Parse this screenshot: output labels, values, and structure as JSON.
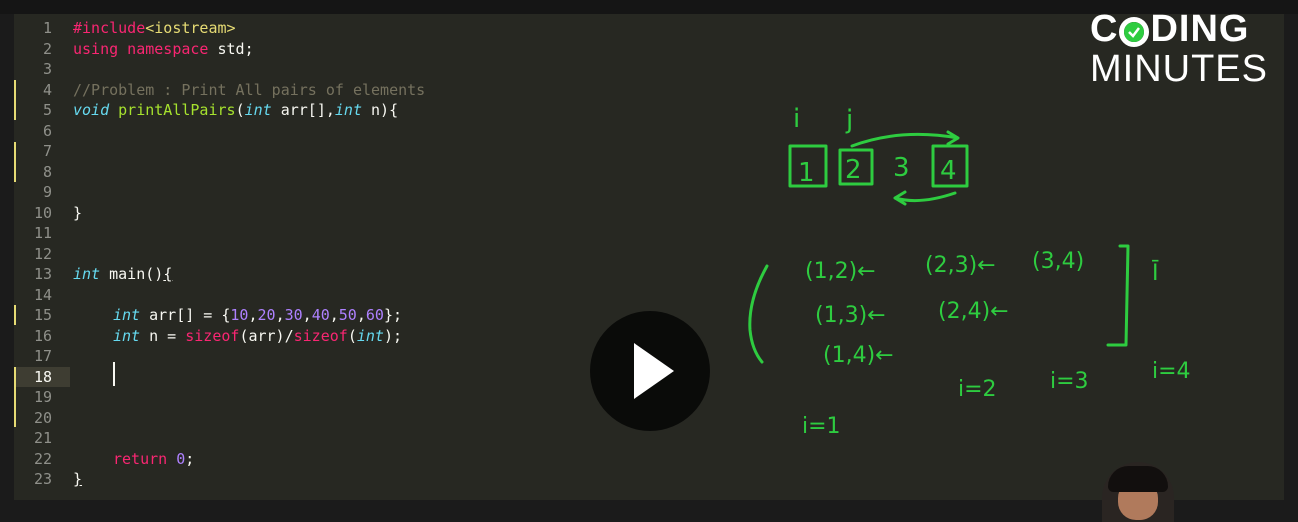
{
  "editor": {
    "active_line": 18,
    "line_numbers": [
      "1",
      "2",
      "3",
      "4",
      "5",
      "6",
      "7",
      "8",
      "9",
      "10",
      "11",
      "12",
      "13",
      "14",
      "15",
      "16",
      "17",
      "18",
      "19",
      "20",
      "21",
      "22",
      "23"
    ],
    "lines": {
      "l1_pre": "#include",
      "l1_post": "<iostream>",
      "l2_kw": "using namespace",
      "l2_rest": " std;",
      "l4": "//Problem : Print All pairs of elements",
      "l5_void": "void",
      "l5_fn": "printAllPairs",
      "l5_p1": "(",
      "l5_int1": "int",
      "l5_p2": " arr[],",
      "l5_int2": "int",
      "l5_p3": " n){",
      "l10": "}",
      "l13_int": "int",
      "l13_main": " main()",
      "l13_brace": "{",
      "l15_int": "int",
      "l15_a": " arr[] = {",
      "l15_n1": "10",
      "l15_n2": "20",
      "l15_n3": "30",
      "l15_n4": "40",
      "l15_n5": "50",
      "l15_n6": "60",
      "l15_b": "};",
      "comma": ",",
      "l16_int": "int",
      "l16_a": " n = ",
      "l16_sz1": "sizeof",
      "l16_b": "(arr)/",
      "l16_sz2": "sizeof",
      "l16_c": "(",
      "l16_int2": "int",
      "l16_d": ");",
      "l22_ret": "return",
      "l22_zero": "0",
      "l22_semi": ";",
      "l23": "}"
    }
  },
  "logo": {
    "line1_a": "C",
    "line1_b": "DING",
    "line2": "MINUTES"
  },
  "video": {
    "play_button_icon": "play-icon"
  },
  "handwriting": {
    "i_label": "i",
    "j_label": "j",
    "boxes": [
      "1",
      "2",
      "3",
      "4"
    ],
    "pairs_row1": [
      "(1,2)←",
      "(2,3)←",
      "(3,4)"
    ],
    "pairs_row2": [
      "(1,3)←",
      "(2,4)←"
    ],
    "pairs_row3": [
      "(1,4)←"
    ],
    "iter_labels": [
      "i=1",
      "i=2",
      "i=3",
      "i=4"
    ],
    "roman": "Ī"
  },
  "colors": {
    "background": "#272822",
    "ink": "#2ecc40",
    "keyword": "#f92672",
    "type": "#66d9ef",
    "function": "#a6e22e",
    "number": "#ae81ff",
    "string": "#e6db74",
    "comment": "#75715e"
  }
}
